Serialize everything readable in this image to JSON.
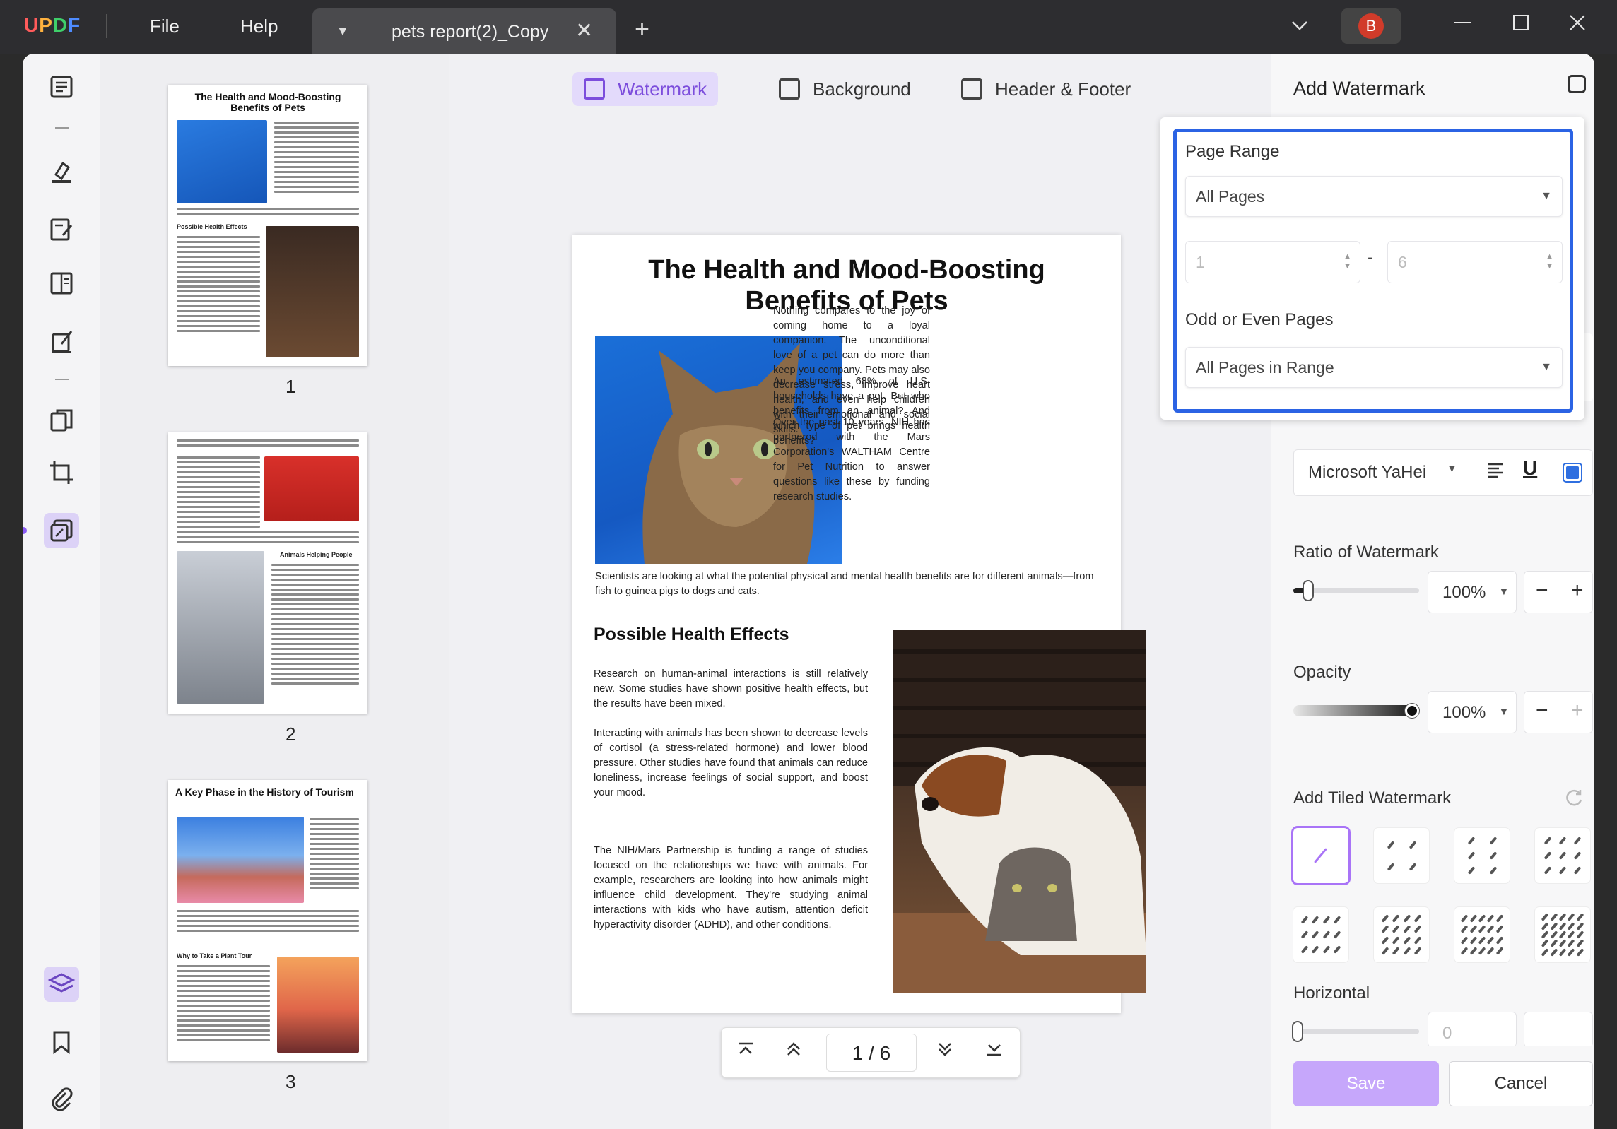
{
  "app": {
    "logo": "UPDF",
    "logo_colors": [
      "#ff5b5b",
      "#ffb23f",
      "#3fcf6a",
      "#4e8cff"
    ],
    "menu": [
      "File",
      "Help"
    ],
    "tab_title": "pets report(2)_Copy",
    "user_initial": "B"
  },
  "toolbar": {
    "watermark": "Watermark",
    "background": "Background",
    "header_footer": "Header & Footer"
  },
  "thumbnails": {
    "page1_title": "The Health and Mood-Boosting Benefits of Pets",
    "page1_sub": "Possible Health Effects",
    "page2_sub": "Animals Helping People",
    "page3_title": "A Key Phase in the History of Tourism",
    "page3_sub": "Why to Take a Plant Tour",
    "numbers": [
      "1",
      "2",
      "3"
    ]
  },
  "document": {
    "title": "The Health and Mood-Boosting Benefits of Pets",
    "para1": "Nothing compares to the joy of coming home to a loyal companion. The unconditional love of a pet can do more than keep you company. Pets may also decrease stress, improve heart health, and even help children with their emotional and social skills.",
    "para2": "An estimated 68% of U.S. households have a pet. But who benefits from an animal? And which type of pet brings health benefits?",
    "para3": "Over the past 10 years, NIH has partnered with the Mars Corporation's WALTHAM Centre for Pet Nutrition to answer questions like these by funding research studies.",
    "para4": "Scientists are looking at what the potential physical and mental health benefits are for different animals—from fish to guinea pigs to dogs and cats.",
    "subheading": "Possible Health Effects",
    "para5": "Research on human-animal interactions is still relatively new. Some studies have shown positive health effects, but the results have been mixed.",
    "para6": "Interacting with animals has been shown to decrease levels of cortisol (a stress-related hormone) and lower blood pressure. Other studies have found that animals can reduce loneliness, increase feelings of social support, and boost your mood.",
    "para7": "The NIH/Mars Partnership is funding a range of studies focused on the relationships we have with animals. For example, researchers are looking into how animals might influence child development. They're studying animal interactions with kids who have autism, attention deficit hyperactivity disorder (ADHD), and other conditions."
  },
  "pager": {
    "current": "1",
    "separator": "/",
    "total": "6"
  },
  "panel": {
    "title": "Add Watermark",
    "font": "Microsoft YaHei",
    "ratio_label": "Ratio of Watermark",
    "ratio_value": "100%",
    "ratio_level": 0.12,
    "opacity_label": "Opacity",
    "opacity_value": "100%",
    "opacity_level": 1.0,
    "tiled_label": "Add Tiled Watermark",
    "horizontal_label": "Horizontal",
    "horizontal_value": "0",
    "save": "Save",
    "cancel": "Cancel"
  },
  "popover": {
    "page_range_label": "Page Range",
    "page_range_value": "All Pages",
    "from_placeholder": "1",
    "to_placeholder": "6",
    "range_dash": "-",
    "odd_even_label": "Odd or Even Pages",
    "odd_even_value": "All Pages in Range"
  },
  "colors": {
    "accent": "#8b5cf6",
    "popover_border": "#2b63e4",
    "save_button": "#c6a7fb",
    "color_swatch": "#2f6fe0"
  }
}
